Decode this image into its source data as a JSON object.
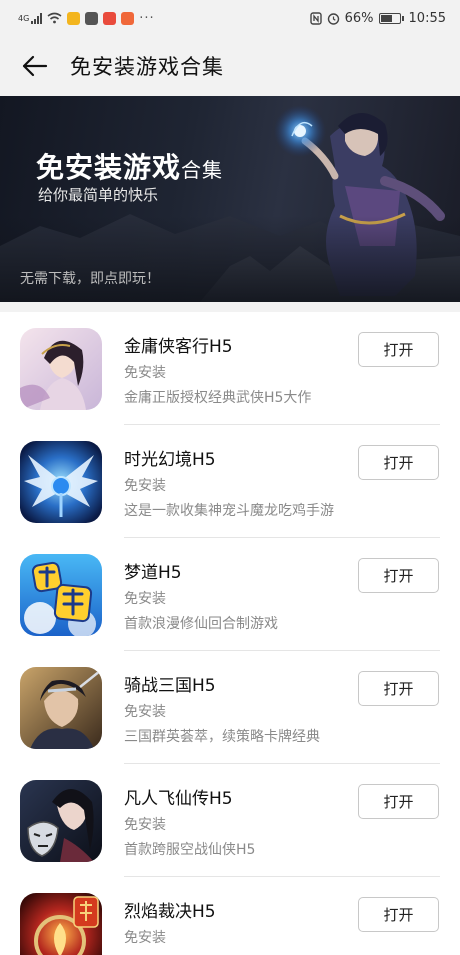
{
  "status_bar": {
    "network": "4G",
    "battery": "66%",
    "battery_level": 0.66,
    "time": "10:55",
    "more": "···"
  },
  "header": {
    "title": "免安装游戏合集"
  },
  "banner": {
    "title_main": "免安装游戏",
    "title_suffix": "合集",
    "subtitle": "给你最简单的快乐",
    "footer": "无需下载，即点即玩！"
  },
  "games": [
    {
      "name": "金庸侠客行H5",
      "tag": "免安装",
      "desc": "金庸正版授权经典武侠H5大作",
      "button": "打开",
      "icon": "character-portrait-icon"
    },
    {
      "name": "时光幻境H5",
      "tag": "免安装",
      "desc": "这是一款收集神宠斗魔龙吃鸡手游",
      "button": "打开",
      "icon": "winged-emblem-icon"
    },
    {
      "name": "梦道H5",
      "tag": "免安装",
      "desc": "首款浪漫修仙回合制游戏",
      "button": "打开",
      "icon": "mengdao-logo-icon"
    },
    {
      "name": "骑战三国H5",
      "tag": "免安装",
      "desc": "三国群英荟萃，续策略卡牌经典",
      "button": "打开",
      "icon": "warrior-portrait-icon"
    },
    {
      "name": "凡人飞仙传H5",
      "tag": "免安装",
      "desc": "首款跨服空战仙侠H5",
      "button": "打开",
      "icon": "masked-hero-icon"
    },
    {
      "name": "烈焰裁决H5",
      "tag": "免安装",
      "desc": "",
      "button": "打开",
      "icon": "flame-emblem-icon"
    }
  ]
}
